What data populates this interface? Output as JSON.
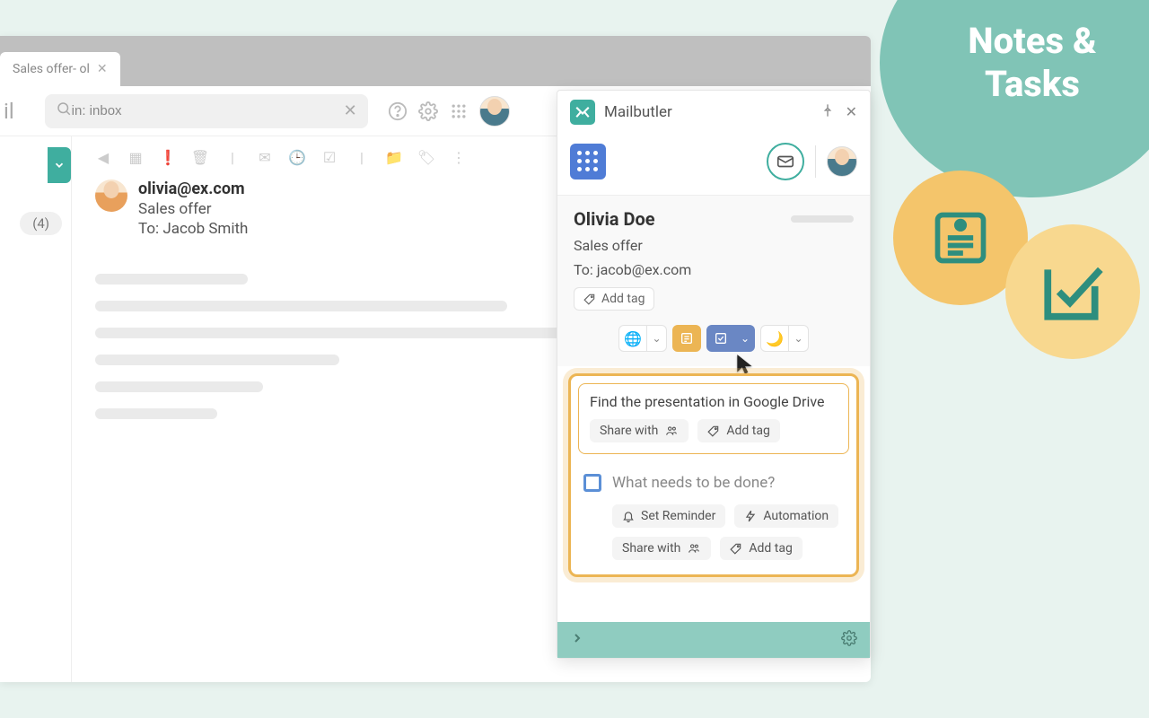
{
  "promo": {
    "line1": "Notes &",
    "line2": "Tasks"
  },
  "tab": {
    "title": "Sales offer- ol"
  },
  "toolbar": {
    "mail_prefix": "il",
    "search_value": "in: inbox"
  },
  "sidebar": {
    "inbox_count": "(4)"
  },
  "email": {
    "from": "olivia@ex.com",
    "subject": "Sales offer",
    "to": "To: Jacob Smith"
  },
  "panel": {
    "title": "Mailbutler",
    "contact_name": "Olivia Doe",
    "contact_subject": "Sales offer",
    "contact_to": "To: jacob@ex.com",
    "add_tag": "Add tag"
  },
  "note": {
    "text": "Find the presentation in Google Drive",
    "share_with": "Share with",
    "add_tag": "Add tag"
  },
  "task": {
    "placeholder": "What needs to be done?",
    "set_reminder": "Set Reminder",
    "automation": "Automation",
    "share_with": "Share with",
    "add_tag": "Add tag"
  }
}
